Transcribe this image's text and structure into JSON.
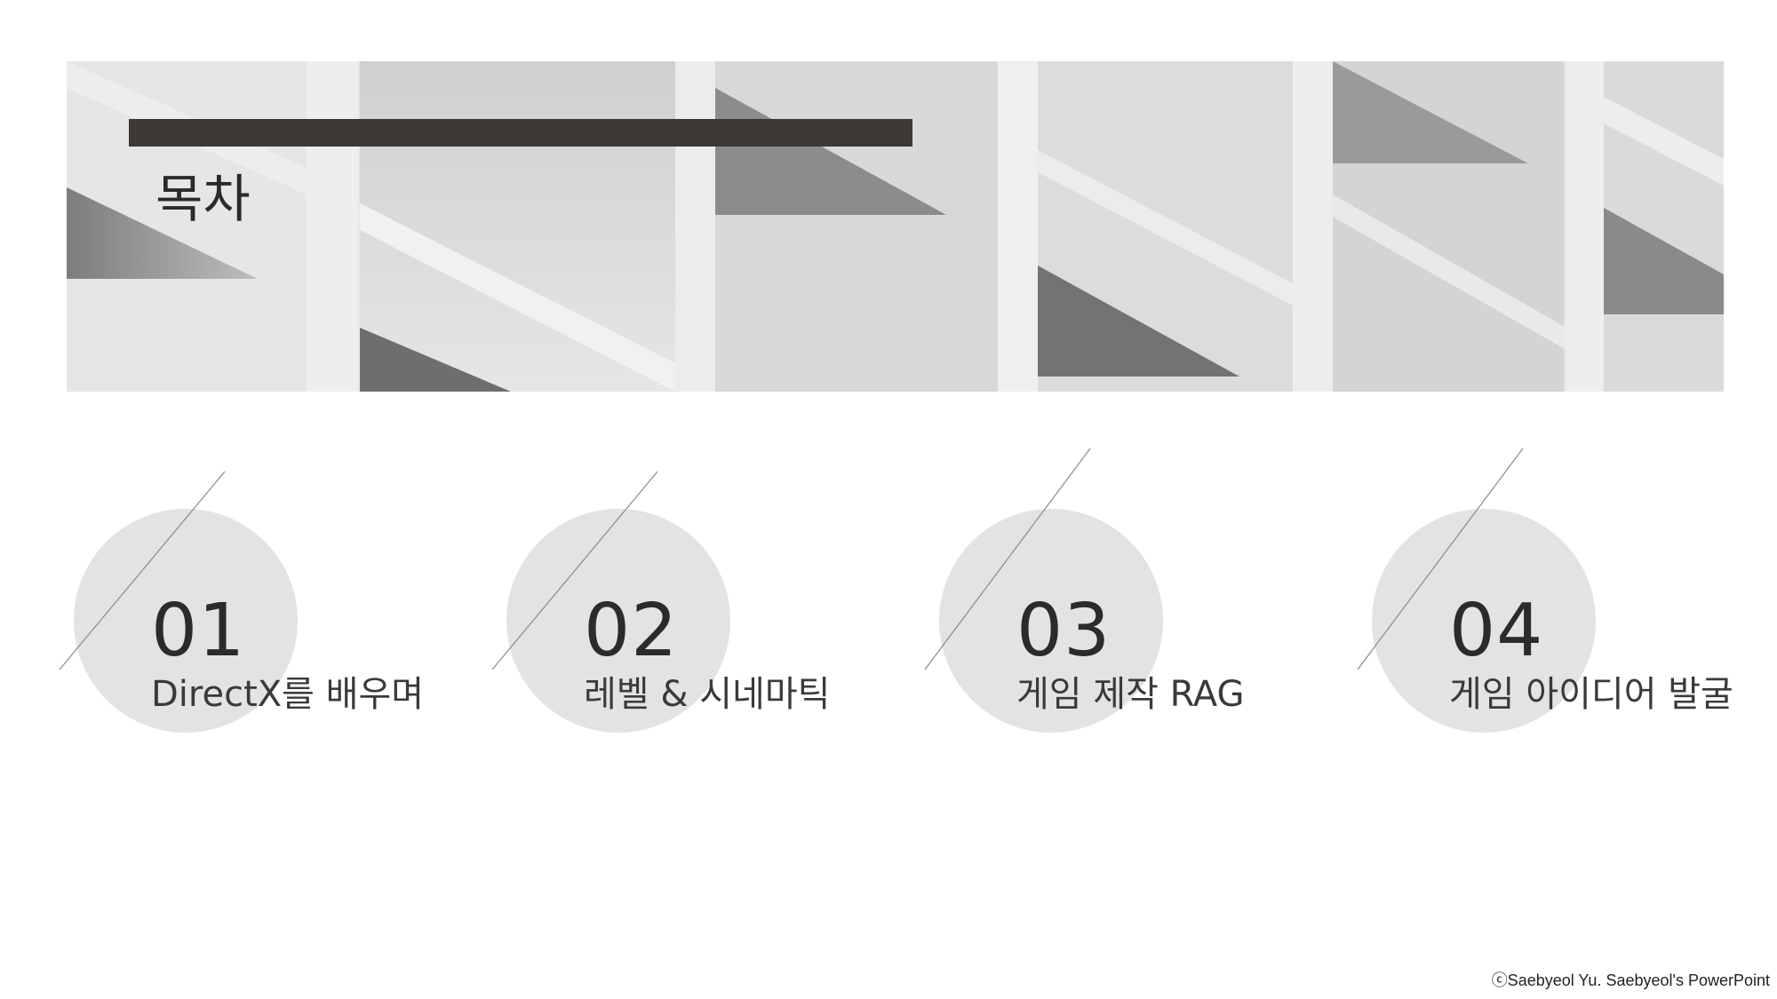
{
  "title": "목차",
  "items": [
    {
      "number": "01",
      "label": "DirectX를 배우며"
    },
    {
      "number": "02",
      "label": "레벨 & 시네마틱"
    },
    {
      "number": "03",
      "label": "게임 제작 RAG"
    },
    {
      "number": "04",
      "label": "게임 아이디어 발굴"
    }
  ],
  "footer": {
    "copyright": "ⓒSaebyeol Yu. Saebyeol's PowerPoint"
  },
  "colors": {
    "title_bar": "#3b3835",
    "circle": "#e3e3e3",
    "text": "#2b2b2b"
  }
}
